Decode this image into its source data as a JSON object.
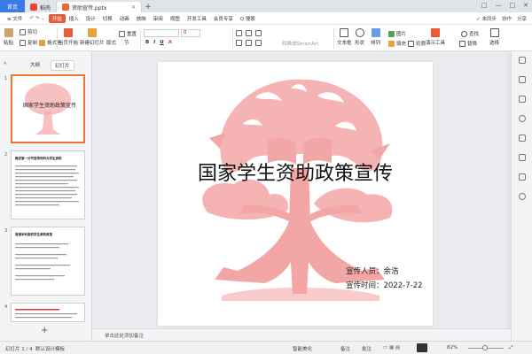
{
  "tabs": {
    "home": "首页",
    "items": [
      {
        "label": "稻壳",
        "color": "#e8463a"
      },
      {
        "label": "资助宣传.pptx",
        "color": "#e8663a"
      }
    ],
    "new_tab": "+"
  },
  "window_controls": [
    "□",
    "—",
    "□",
    "✕"
  ],
  "menu": {
    "file": "≡ 文件",
    "items": [
      "开始",
      "插入",
      "设计",
      "切换",
      "动画",
      "放映",
      "审阅",
      "视图",
      "开发工具",
      "会员专享"
    ],
    "active": "开始",
    "search": "Q 搜索",
    "right": [
      "✓ 未同步",
      "协作",
      "分享"
    ]
  },
  "ribbon": {
    "paste": "粘贴",
    "cut": "剪切",
    "copy": "复制",
    "format_painter": "格式刷",
    "from_current": "当页开始",
    "new_slide": "新建幻灯片",
    "layout": "版式",
    "section": "节",
    "reset": "重置",
    "bold": "B",
    "italic": "I",
    "underline": "U",
    "font_size": "0",
    "textbox": "文本框",
    "shape": "形状",
    "arrange": "排列",
    "picture": "图片",
    "fill": "填充",
    "outline": "轮廓",
    "replace": "替换",
    "select": "选择",
    "find": "查找",
    "show_tools": "演示工具",
    "convert_smartart": "转换成SmartArt"
  },
  "leftpanel": {
    "tab_outline": "大纲",
    "tab_slides": "幻灯片",
    "slides": [
      {
        "num": "1",
        "title": "国家学生资助政策宣传"
      },
      {
        "num": "2",
        "title": "概述第一分节宣传材料大学生资助"
      },
      {
        "num": "3",
        "title": "普通本科高校学生资助政策"
      },
      {
        "num": "4",
        "title": ""
      }
    ],
    "add": "+"
  },
  "slide": {
    "title": "国家学生资助政策宣传",
    "presenter_label": "宣传人员：",
    "presenter": "余浩",
    "date_label": "宣传时间：",
    "date": "2022-7-22"
  },
  "notes_placeholder": "单击此处添加备注",
  "status": {
    "slide_counter": "幻灯片 1 / 4",
    "theme": "默认设计模板",
    "beautify": "智能美化",
    "notes": "备注",
    "comments": "批注",
    "zoom": "82%"
  },
  "colors": {
    "accent": "#e75a3a",
    "home_tab": "#3a7be8",
    "tree": "#f3a6a6",
    "selected_thumb": "#e8762e"
  }
}
